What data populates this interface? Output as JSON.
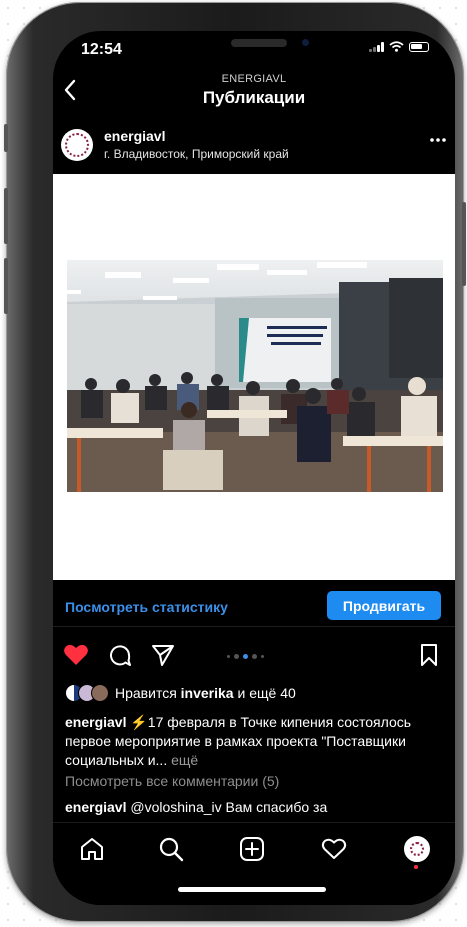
{
  "status": {
    "time": "12:54"
  },
  "header": {
    "account": "ENERGIAVL",
    "title": "Публикации"
  },
  "post": {
    "username": "energiavl",
    "location": "г. Владивосток, Приморский край",
    "image_icon": "conference-photo"
  },
  "insights": {
    "stats_link": "Посмотреть статистику",
    "promote_button": "Продвигать"
  },
  "actions": {
    "carousel_count": 5,
    "carousel_active": 3
  },
  "likes": {
    "prefix": "Нравится",
    "user": "inverika",
    "suffix": "и ещё 40"
  },
  "caption": {
    "username": "energiavl",
    "text": "⚡17 февраля в Точке кипения состоялось первое мероприятие в рамках проекта \"Поставщики социальных и...",
    "more": "ещё"
  },
  "comments": {
    "view_all": "Посмотреть все комментарии (5)",
    "first": {
      "username": "energiavl",
      "text": "@voloshina_iv Вам спасибо за"
    }
  },
  "colors": {
    "accent": "#1d8bf0",
    "link": "#3b8fe8",
    "like": "#ff3040"
  }
}
